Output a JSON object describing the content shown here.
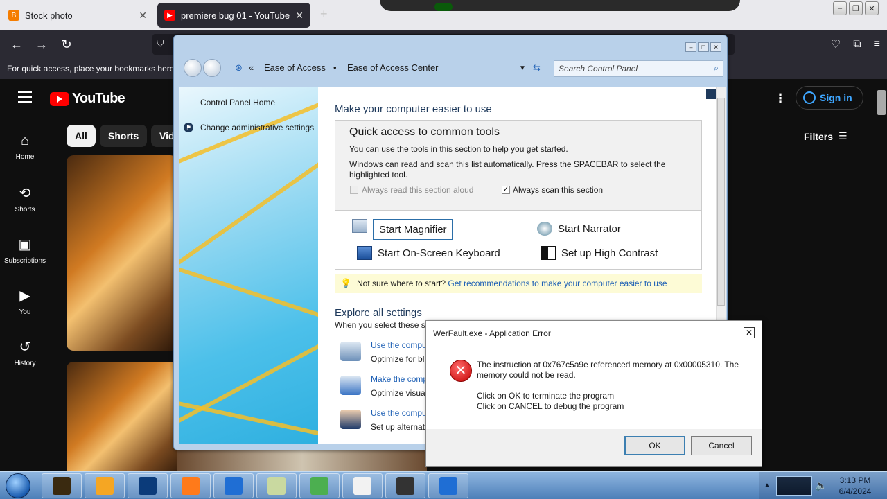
{
  "browser": {
    "tabs": [
      {
        "label": "Stock photo",
        "favicon": "blogger-icon",
        "active": false
      },
      {
        "label": "premiere bug 01 - YouTube",
        "favicon": "youtube-icon",
        "active": true
      }
    ],
    "new_tab": "+",
    "bookmarks_text": "For quick access, place your bookmarks here on the bookmarks toolbar."
  },
  "youtube": {
    "logo_text": "YouTube",
    "sidebar": [
      {
        "label": "Home",
        "icon": "home-icon",
        "glyph": "⌂"
      },
      {
        "label": "Shorts",
        "icon": "shorts-icon",
        "glyph": "⟲"
      },
      {
        "label": "Subscriptions",
        "icon": "subscriptions-icon",
        "glyph": "▣"
      },
      {
        "label": "You",
        "icon": "you-icon",
        "glyph": "▶"
      },
      {
        "label": "History",
        "icon": "history-icon",
        "glyph": "↺"
      }
    ],
    "chips": [
      "All",
      "Shorts",
      "Vid"
    ],
    "sign_in": "Sign in",
    "filters": "Filters"
  },
  "control_panel": {
    "breadcrumbs": [
      "Ease of Access",
      "Ease of Access Center"
    ],
    "search_placeholder": "Search Control Panel",
    "left_links": [
      "Control Panel Home",
      "Change administrative settings"
    ],
    "heading": "Make your computer easier to use",
    "quick_access": {
      "title": "Quick access to common tools",
      "desc1": "You can use the tools in this section to help you get started.",
      "desc2": "Windows can read and scan this list automatically.  Press the SPACEBAR to select the",
      "desc3": "highlighted tool.",
      "check_read": {
        "label": "Always read this section aloud",
        "checked": false,
        "enabled": false
      },
      "check_scan": {
        "label": "Always scan this section",
        "checked": true,
        "enabled": true
      }
    },
    "tools": [
      {
        "label": "Start Magnifier",
        "icon": "magnifier-icon"
      },
      {
        "label": "Start Narrator",
        "icon": "narrator-icon"
      },
      {
        "label": "Start On-Screen Keyboard",
        "icon": "keyboard-icon"
      },
      {
        "label": "Set up High Contrast",
        "icon": "high-contrast-icon"
      }
    ],
    "hint": {
      "text": "Not sure where to start?",
      "link": "Get recommendations to make your computer easier to use"
    },
    "explore": {
      "title": "Explore all settings",
      "subtitle": "When you select these se",
      "items": [
        {
          "link": "Use the compu",
          "desc": "Optimize for bl"
        },
        {
          "link": "Make the comp",
          "desc": "Optimize visual"
        },
        {
          "link": "Use the compu",
          "desc": "Set up alternati"
        }
      ]
    }
  },
  "error_dialog": {
    "title": "WerFault.exe - Application Error",
    "line1": "The instruction at 0x767c5a9e referenced memory at 0x00005310. The",
    "line2": "memory could not be read.",
    "line3": "Click on OK to terminate the program",
    "line4": "Click on CANCEL to debug the program",
    "ok": "OK",
    "cancel": "Cancel"
  },
  "taskbar": {
    "time": "3:13 PM",
    "date": "6/4/2024",
    "items": [
      {
        "name": "taskbar-app-1",
        "color": "#3a2a10"
      },
      {
        "name": "taskbar-app-2",
        "color": "#f5a623"
      },
      {
        "name": "taskbar-app-3",
        "color": "#0b3b7a"
      },
      {
        "name": "taskbar-firefox",
        "color": "#ff7a1a"
      },
      {
        "name": "taskbar-app-5",
        "color": "#1f6ed4"
      },
      {
        "name": "taskbar-control-panel",
        "color": "#c9d9a0"
      },
      {
        "name": "taskbar-app-7",
        "color": "#4caf50"
      },
      {
        "name": "taskbar-app-8",
        "color": "#f2f2f2"
      },
      {
        "name": "taskbar-app-9",
        "color": "#333333"
      },
      {
        "name": "taskbar-app-10",
        "color": "#1f6ed4"
      }
    ]
  },
  "colors": {
    "youtube_red": "#ff0000",
    "link_blue": "#1e60b5",
    "heading_blue": "#1e395b"
  }
}
